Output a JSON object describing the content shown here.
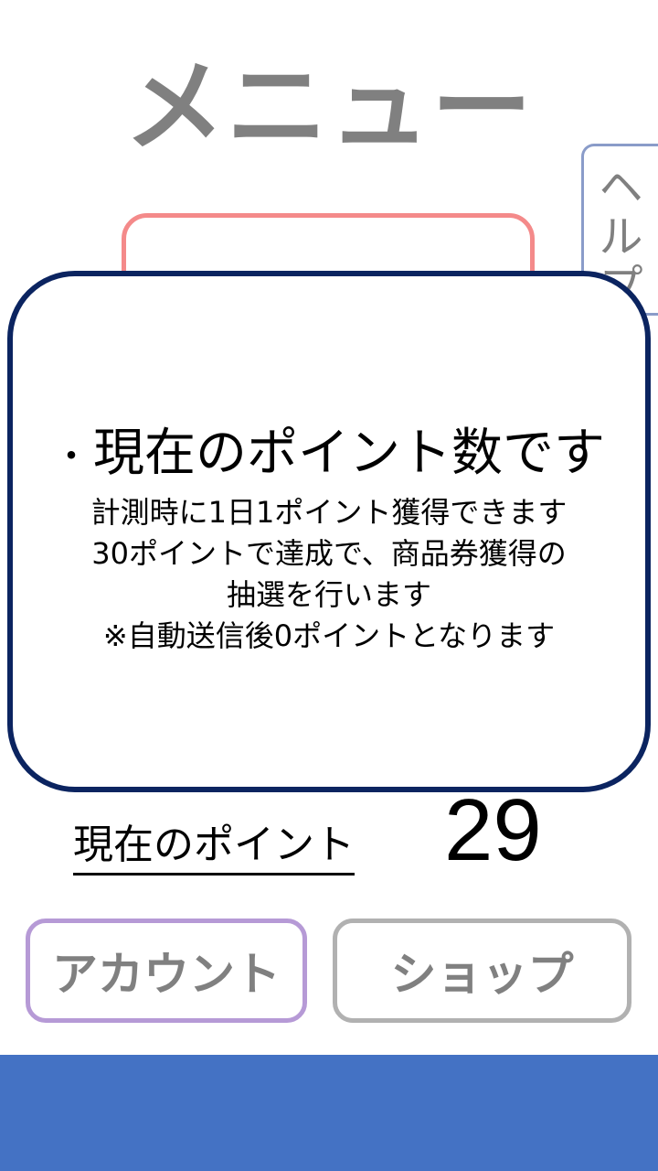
{
  "header": {
    "title": "メニュー"
  },
  "help_tab": {
    "label_chars": [
      "ヘ",
      "ル",
      "プ"
    ]
  },
  "modal": {
    "heading_bullet": "・",
    "heading": "現在のポイント数です",
    "lines": [
      "計測時に1日1ポイント獲得できます",
      "30ポイントで達成で、商品券獲得の",
      "抽選を行います",
      "※自動送信後0ポイントとなります"
    ]
  },
  "points": {
    "label": "現在のポイント",
    "value": "29"
  },
  "buttons": {
    "account": "アカウント",
    "shop": "ショップ"
  },
  "colors": {
    "modal_border": "#0b2460",
    "behind_button_border": "#f48a8a",
    "account_border": "#b69ad6",
    "shop_border": "#b1b1b1",
    "help_border": "#8a9cc9",
    "bottom_bar": "#4472c4",
    "muted_text": "#808080"
  }
}
